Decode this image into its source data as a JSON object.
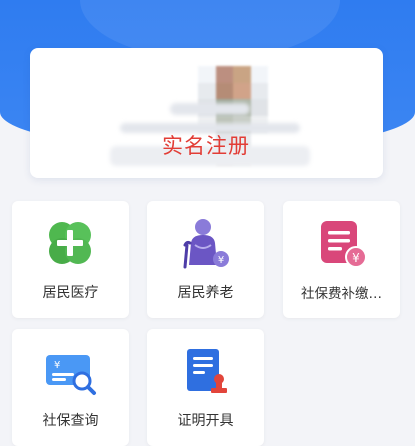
{
  "profile": {
    "register_label": "实名注册"
  },
  "services": [
    {
      "label": "居民医疗",
      "icon": "medical-cross-icon",
      "color": "#4bb24c"
    },
    {
      "label": "居民养老",
      "icon": "elderly-person-icon",
      "color": "#6b56c4"
    },
    {
      "label": "社保费补缴…",
      "icon": "bill-payment-icon",
      "color": "#d9477a"
    },
    {
      "label": "社保查询",
      "icon": "card-search-icon",
      "color": "#3a8ef0"
    },
    {
      "label": "证明开具",
      "icon": "certificate-stamp-icon",
      "color": "#2f6fe0"
    }
  ]
}
